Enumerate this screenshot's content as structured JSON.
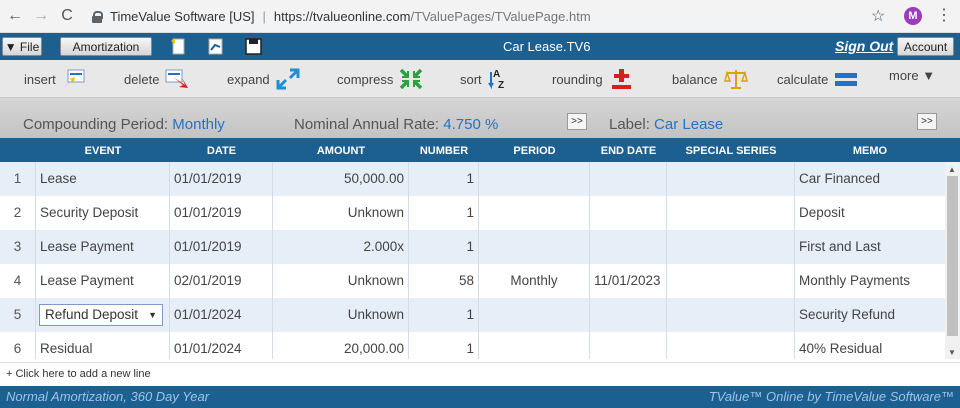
{
  "browser": {
    "back": "←",
    "forward": "→",
    "reload": "C",
    "site": "TimeValue Software [US]",
    "url_host": "https://tvalueonline.com",
    "url_path": "/TValuePages/TValuePage.htm",
    "profile_initial": "M"
  },
  "header": {
    "file_label": "▼ File",
    "amortization_label": "Amortization",
    "title": "Car Lease.TV6",
    "sign_out": "Sign Out",
    "account_label": "Account"
  },
  "toolbar": {
    "insert": "insert",
    "delete": "delete",
    "expand": "expand",
    "compress": "compress",
    "sort": "sort",
    "rounding": "rounding",
    "balance": "balance",
    "calculate": "calculate",
    "more": "more ▼"
  },
  "settings": {
    "compounding_label": "Compounding Period:",
    "compounding_value": "Monthly",
    "rate_label": "Nominal Annual Rate:",
    "rate_value": "4.750 %",
    "next_btn": ">>",
    "label_label": "Label:",
    "label_value": "Car Lease",
    "expand_btn": ">>"
  },
  "table": {
    "headers": {
      "event": "EVENT",
      "date": "DATE",
      "amount": "AMOUNT",
      "number": "NUMBER",
      "period": "PERIOD",
      "end_date": "END DATE",
      "special": "SPECIAL SERIES",
      "memo": "MEMO"
    },
    "rows": [
      {
        "n": "1",
        "event": "Lease",
        "date": "01/01/2019",
        "amount": "50,000.00",
        "number": "1",
        "period": "",
        "end_date": "",
        "special": "",
        "memo": "Car Financed"
      },
      {
        "n": "2",
        "event": "Security Deposit",
        "date": "01/01/2019",
        "amount": "Unknown",
        "number": "1",
        "period": "",
        "end_date": "",
        "special": "",
        "memo": "Deposit"
      },
      {
        "n": "3",
        "event": "Lease Payment",
        "date": "01/01/2019",
        "amount": "2.000x",
        "number": "1",
        "period": "",
        "end_date": "",
        "special": "",
        "memo": "First and Last"
      },
      {
        "n": "4",
        "event": "Lease Payment",
        "date": "02/01/2019",
        "amount": "Unknown",
        "number": "58",
        "period": "Monthly",
        "end_date": "11/01/2023",
        "special": "",
        "memo": "Monthly Payments"
      },
      {
        "n": "5",
        "event": "Refund Deposit",
        "date": "01/01/2024",
        "amount": "Unknown",
        "number": "1",
        "period": "",
        "end_date": "",
        "special": "",
        "memo": "Security Refund"
      },
      {
        "n": "6",
        "event": "Residual",
        "date": "01/01/2024",
        "amount": "20,000.00",
        "number": "1",
        "period": "",
        "end_date": "",
        "special": "",
        "memo": "40% Residual"
      }
    ]
  },
  "add_line": "+  Click here to add a new line",
  "footer": {
    "left": "Normal Amortization, 360 Day Year",
    "right": "TValue™ Online  by TimeValue Software™"
  },
  "colors": {
    "brand_blue": "#1c5f91",
    "link_blue": "#1f73c9",
    "row_alt": "#e6eef7"
  }
}
